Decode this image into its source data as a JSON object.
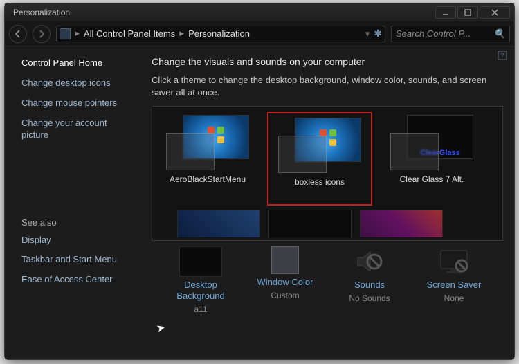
{
  "window": {
    "title": "Personalization"
  },
  "breadcrumb": {
    "item1": "All Control Panel Items",
    "item2": "Personalization"
  },
  "search": {
    "placeholder": "Search Control P..."
  },
  "sidebar": {
    "home": "Control Panel Home",
    "links": [
      "Change desktop icons",
      "Change mouse pointers",
      "Change your account picture"
    ],
    "seealso_label": "See also",
    "seealso": [
      "Display",
      "Taskbar and Start Menu",
      "Ease of Access Center"
    ]
  },
  "main": {
    "heading": "Change the visuals and sounds on your computer",
    "subtext": "Click a theme to change the desktop background, window color, sounds, and screen saver all at once.",
    "themes": [
      {
        "name": "AeroBlackStartMenu",
        "selected": false,
        "style": "win7"
      },
      {
        "name": "boxless icons",
        "selected": true,
        "style": "win7"
      },
      {
        "name": "Clear Glass 7 Alt.",
        "selected": false,
        "style": "clearglass"
      }
    ]
  },
  "options": {
    "background": {
      "label": "Desktop Background",
      "value": "a11"
    },
    "color": {
      "label": "Window Color",
      "value": "Custom"
    },
    "sounds": {
      "label": "Sounds",
      "value": "No Sounds"
    },
    "saver": {
      "label": "Screen Saver",
      "value": "None"
    }
  }
}
